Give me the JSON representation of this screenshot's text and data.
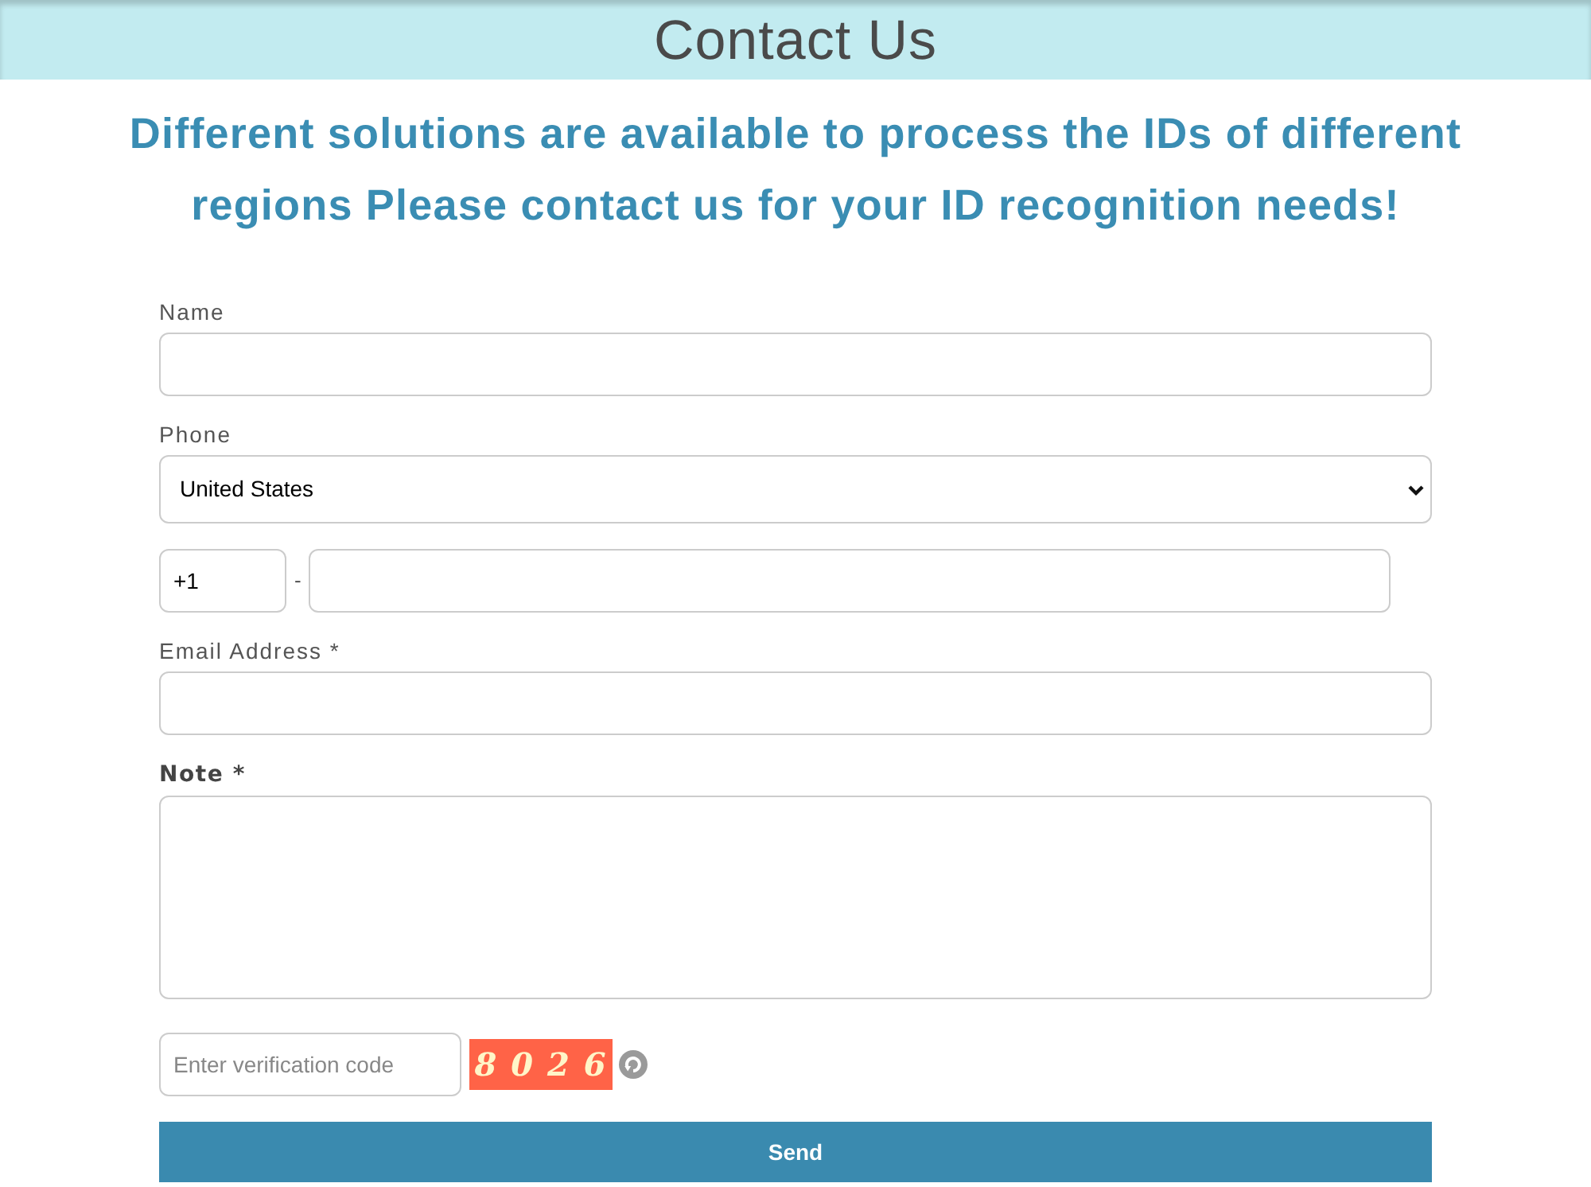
{
  "header": {
    "title": "Contact Us"
  },
  "intro": "Different solutions are available to process the IDs of different regions Please contact us for your ID recognition needs!",
  "form": {
    "fields": [
      {
        "kind": "text",
        "label": "Name"
      },
      {
        "kind": "select",
        "label": "Phone",
        "value": "United States"
      },
      {
        "kind": "phone",
        "code": "+1",
        "separator": "-"
      },
      {
        "kind": "text",
        "label": "Email Address *"
      },
      {
        "kind": "textarea",
        "label": "Note *"
      }
    ],
    "captcha": {
      "placeholder": "Enter verification code",
      "code": "8 0 2 6"
    },
    "submit": "Send"
  }
}
